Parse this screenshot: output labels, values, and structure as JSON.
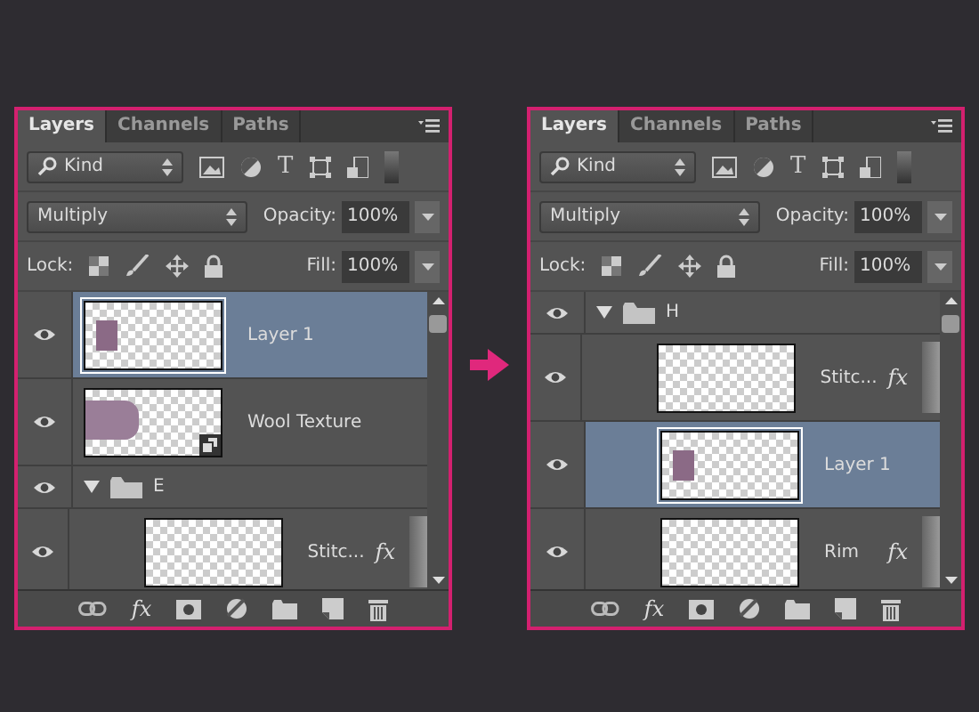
{
  "panels": [
    {
      "tabs": [
        {
          "label": "Layers",
          "selected": true
        },
        {
          "label": "Channels",
          "selected": false
        },
        {
          "label": "Paths",
          "selected": false
        }
      ],
      "filter": {
        "value": "Kind",
        "type_icon": "T"
      },
      "blend_mode": "Multiply",
      "opacity": {
        "label": "Opacity:",
        "value": "100%"
      },
      "lock_label": "Lock:",
      "fill": {
        "label": "Fill:",
        "value": "100%"
      },
      "layers": [
        {
          "kind": "layer",
          "name": "Layer 1",
          "visible": true,
          "selected": true,
          "thumbnail": {
            "kind": "letter"
          },
          "smart_object": false
        },
        {
          "kind": "layer",
          "name": "Wool Texture",
          "visible": true,
          "selected": false,
          "thumbnail": {
            "kind": "blob"
          },
          "smart_object": true
        },
        {
          "kind": "group",
          "name": "E",
          "visible": true,
          "selected": false,
          "expanded": true,
          "children": [
            {
              "kind": "layer",
              "name": "Stitc...",
              "visible": true,
              "selected": false,
              "thumbnail": {
                "kind": "blank"
              },
              "smart_object": false,
              "fx": "fx"
            }
          ]
        }
      ],
      "footer_fx": "fx"
    },
    {
      "tabs": [
        {
          "label": "Layers",
          "selected": true
        },
        {
          "label": "Channels",
          "selected": false
        },
        {
          "label": "Paths",
          "selected": false
        }
      ],
      "filter": {
        "value": "Kind",
        "type_icon": "T"
      },
      "blend_mode": "Multiply",
      "opacity": {
        "label": "Opacity:",
        "value": "100%"
      },
      "lock_label": "Lock:",
      "fill": {
        "label": "Fill:",
        "value": "100%"
      },
      "layers": [
        {
          "kind": "group",
          "name": "H",
          "visible": true,
          "selected": false,
          "expanded": true,
          "children": [
            {
              "kind": "layer",
              "name": "Stitc...",
              "visible": true,
              "selected": false,
              "thumbnail": {
                "kind": "blank"
              },
              "smart_object": false,
              "fx": "fx"
            },
            {
              "kind": "layer",
              "name": "Layer 1",
              "visible": true,
              "selected": true,
              "thumbnail": {
                "kind": "letter"
              },
              "smart_object": false
            },
            {
              "kind": "layer",
              "name": "Rim",
              "visible": true,
              "selected": false,
              "thumbnail": {
                "kind": "blank"
              },
              "smart_object": false,
              "fx": "fx"
            }
          ]
        }
      ],
      "footer_fx": "fx"
    }
  ]
}
